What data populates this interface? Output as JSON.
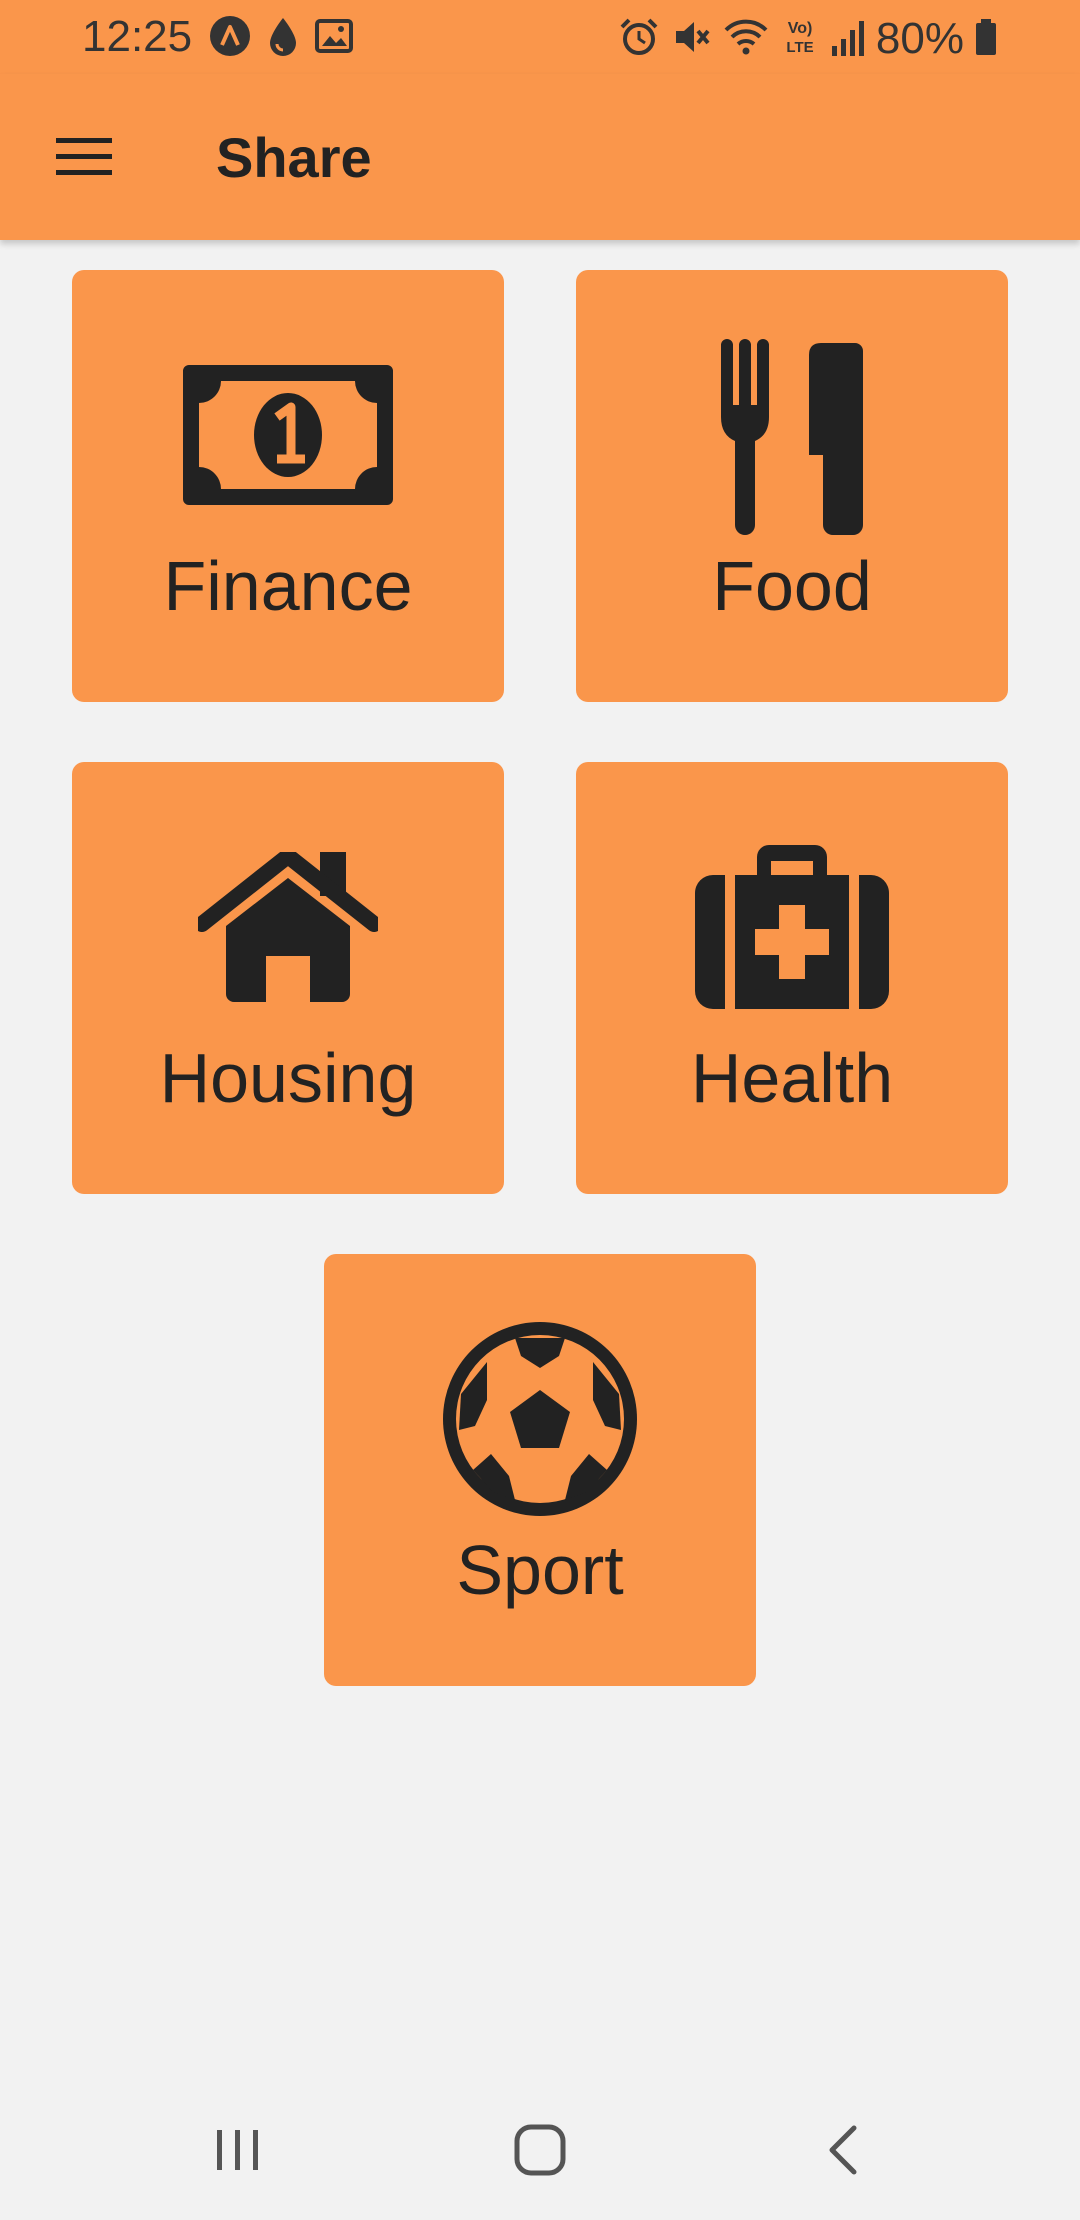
{
  "status_bar": {
    "time": "12:25",
    "battery": "80%"
  },
  "app_bar": {
    "title": "Share"
  },
  "tiles": [
    {
      "label": "Finance",
      "icon": "banknote-icon"
    },
    {
      "label": "Food",
      "icon": "utensils-icon"
    },
    {
      "label": "Housing",
      "icon": "house-icon"
    },
    {
      "label": "Health",
      "icon": "medical-kit-icon"
    },
    {
      "label": "Sport",
      "icon": "soccer-ball-icon"
    }
  ],
  "colors": {
    "primary": "#fa964b",
    "background": "#f2f2f2",
    "icon": "#222222"
  }
}
